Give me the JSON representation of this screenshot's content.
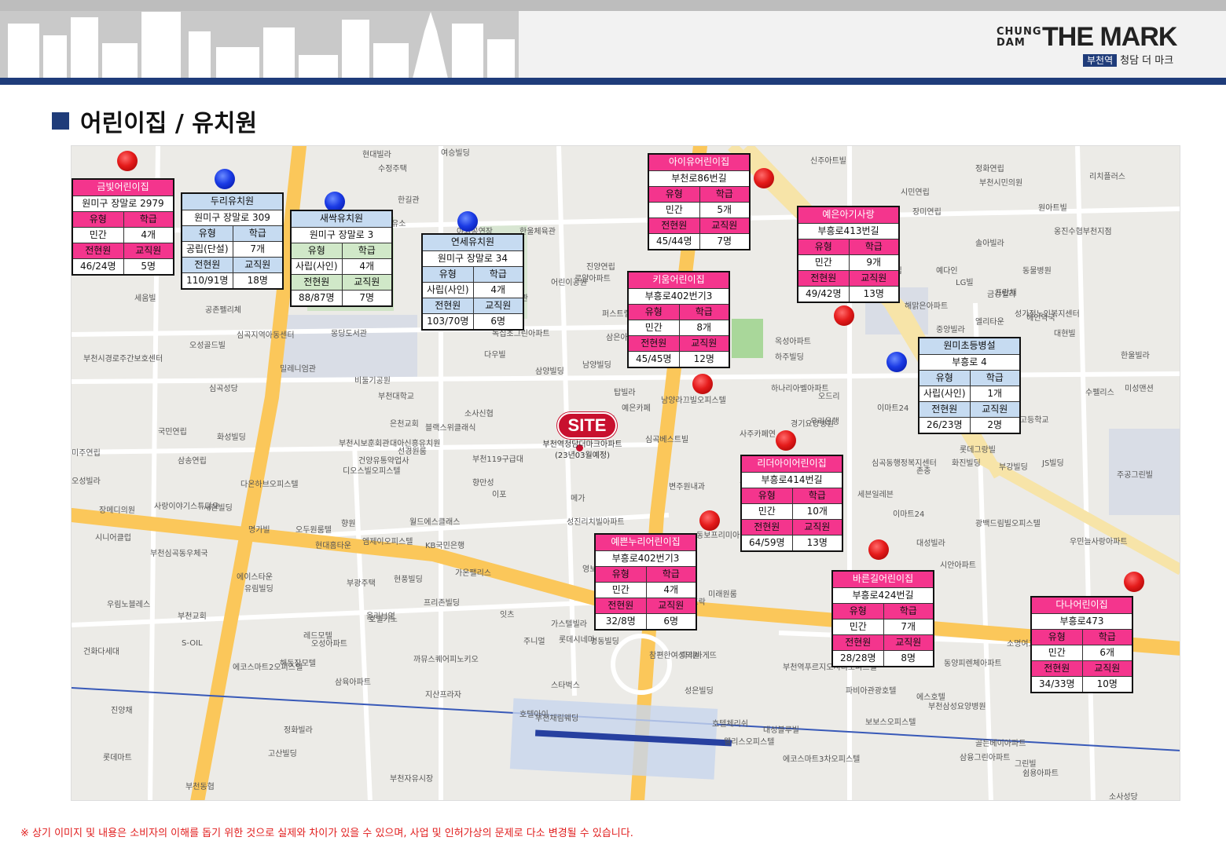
{
  "header": {
    "logo_small_1": "CHUNG",
    "logo_small_2": "DAM",
    "logo_big": "THE MARK",
    "logo_tag": "부천역",
    "logo_sub": "청담 더 마크"
  },
  "title": "어린이집 / 유치원",
  "footnote": "※ 상기 이미지 및 내용은 소비자의 이해를 돕기 위한 것으로 실제와 차이가 있을 수 있으며, 사업 및 인허가상의 문제로 다소 변경될 수 있습니다.",
  "site": {
    "badge": "SITE",
    "label_1": "부천역청담더마크아파트",
    "label_2": "(23년03월예정)"
  },
  "colors": {
    "pink": "#f4358d",
    "blue_header": "#c6dbf1",
    "green_header": "#d0e8c8",
    "brand_navy": "#1f3c7a"
  },
  "facilities": [
    {
      "name": "금빛어린이집",
      "address": "원미구 장말로 2979",
      "type_label": "유형",
      "class_label": "학급",
      "type": "민간",
      "classes": "4개",
      "staff_label": "전현원",
      "teacher_label": "교직원",
      "enrollment": "46/24명",
      "teachers": "5명"
    },
    {
      "name": "두리유치원",
      "address": "원미구 장말로 309",
      "type_label": "유형",
      "class_label": "학급",
      "type": "공립(단설)",
      "classes": "7개",
      "staff_label": "전현원",
      "teacher_label": "교직원",
      "enrollment": "110/91명",
      "teachers": "18명"
    },
    {
      "name": "새싹유치원",
      "address": "원미구 장말로 3",
      "type_label": "유형",
      "class_label": "학급",
      "type": "사립(사인)",
      "classes": "4개",
      "staff_label": "전현원",
      "teacher_label": "교직원",
      "enrollment": "88/87명",
      "teachers": "7명"
    },
    {
      "name": "연세유치원",
      "address": "원미구 장말로 34",
      "type_label": "유형",
      "class_label": "학급",
      "type": "사립(사인)",
      "classes": "4개",
      "staff_label": "전현원",
      "teacher_label": "교직원",
      "enrollment": "103/70명",
      "teachers": "6명"
    },
    {
      "name": "아이유어린이집",
      "address": "부천로86번길",
      "type_label": "유형",
      "class_label": "학급",
      "type": "민간",
      "classes": "5개",
      "staff_label": "전현원",
      "teacher_label": "교직원",
      "enrollment": "45/44명",
      "teachers": "7명"
    },
    {
      "name": "예은아기사랑",
      "address": "부흥로413번길",
      "type_label": "유형",
      "class_label": "학급",
      "type": "민간",
      "classes": "9개",
      "staff_label": "전현원",
      "teacher_label": "교직원",
      "enrollment": "49/42명",
      "teachers": "13명"
    },
    {
      "name": "키움어린이집",
      "address": "부흥로402번기3",
      "type_label": "유형",
      "class_label": "학급",
      "type": "민간",
      "classes": "8개",
      "staff_label": "전현원",
      "teacher_label": "교직원",
      "enrollment": "45/45명",
      "teachers": "12명"
    },
    {
      "name": "원미초등병설",
      "address": "부흥로 4",
      "type_label": "유형",
      "class_label": "학급",
      "type": "사립(사인)",
      "classes": "1개",
      "staff_label": "전현원",
      "teacher_label": "교직원",
      "enrollment": "26/23명",
      "teachers": "2명"
    },
    {
      "name": "리더아이어린이집",
      "address": "부흥로414번길",
      "type_label": "유형",
      "class_label": "학급",
      "type": "민간",
      "classes": "10개",
      "staff_label": "전현원",
      "teacher_label": "교직원",
      "enrollment": "64/59명",
      "teachers": "13명"
    },
    {
      "name": "예쁜누리어린이집",
      "address": "부흥로402번기3",
      "type_label": "유형",
      "class_label": "학급",
      "type": "민간",
      "classes": "4개",
      "staff_label": "전현원",
      "teacher_label": "교직원",
      "enrollment": "32/8명",
      "teachers": "6명"
    },
    {
      "name": "바른길어린이집",
      "address": "부흥로424번길",
      "type_label": "유형",
      "class_label": "학급",
      "type": "민간",
      "classes": "7개",
      "staff_label": "전현원",
      "teacher_label": "교직원",
      "enrollment": "28/28명",
      "teachers": "8명"
    },
    {
      "name": "다나어린이집",
      "address": "부흥로473",
      "type_label": "유형",
      "class_label": "학급",
      "type": "민간",
      "classes": "6개",
      "staff_label": "전현원",
      "teacher_label": "교직원",
      "enrollment": "34/33명",
      "teachers": "10명"
    }
  ],
  "map_labels": [
    "현대빌라",
    "수정주택",
    "여승빌딩",
    "정화연립",
    "부천시민의원",
    "세움빌",
    "공존펠리체",
    "심곡지역아동센터",
    "부천시경로주간보호센터",
    "오성골드빌",
    "밀레니엄관",
    "심곡성당",
    "부천대학교",
    "소사신협",
    "삼양빌딩",
    "국민연립",
    "화성빌딩",
    "미주연립",
    "삼송연립",
    "오성빌라",
    "장메디의원",
    "사랑이야기스튜디오",
    "새한빌딩",
    "시니어클럽",
    "부천심곡동우체국",
    "에이스타운",
    "유림빌딩",
    "우림노블레스",
    "부천교회",
    "S-OIL",
    "건화다세대",
    "에코스마트2오피스텔",
    "해동장모텔",
    "삼육아파트",
    "진양채",
    "롯데마트",
    "부천동협",
    "정화빌라",
    "고산빌딩",
    "부천자유시장",
    "현대홈타운",
    "엠제이오피스텔",
    "월드에스클래스",
    "가온팰리스",
    "프리존빌딩",
    "현풍빌딩",
    "호텔키노",
    "레드모텔",
    "오성아파트",
    "까뮤스퀘어피노키오",
    "지산프라자",
    "스타벅스",
    "호텔아이",
    "부천채림웨딩",
    "웰리스오피스텔",
    "참편한여성의원",
    "파리바게뜨",
    "성은빌딩",
    "호텔체리쉬",
    "대성블루빌",
    "에코스마트3차오피스텔",
    "부천역푸르지오시티오피스텔",
    "파비아관광호텔",
    "보보스오피스텔",
    "에스호텔",
    "부천삼성요양병원",
    "삼융그린아파트",
    "그린빌",
    "골든베이아파트",
    "쉼용아파트",
    "소사성당",
    "오투모텔",
    "소명여고사거리",
    "동양피렌체아파트",
    "우민늘사랑아파트",
    "광백드림빌오피스텔",
    "대성빌라",
    "시안아파트",
    "세븐일레븐",
    "이마트24",
    "심곡동행정복지센터",
    "존충",
    "롯데그랑빌",
    "부강빌딩",
    "화진빌딩",
    "JS빌딩",
    "주공그린빌",
    "소명여자고등학교",
    "범신빌라",
    "수펠리스",
    "미성맨션",
    "한울빌라",
    "대현빌",
    "성가정노인복지센터",
    "금강빌라",
    "중앙빌라",
    "해맑은아파트",
    "메트로센트로아파트",
    "풍전연립",
    "예다인",
    "LG빌",
    "프란채",
    "엘리타운",
    "동물병원",
    "헤인약국",
    "옹진수협부천지점",
    "리치플러스",
    "원아트빌",
    "솔아빌라",
    "장미연립",
    "시민연립",
    "신주아트빌",
    "옥성아파트",
    "하주빌딩",
    "하나리아벨아파트",
    "이마트24",
    "오드리",
    "경기요양병원",
    "우리은행",
    "사주카페연",
    "심곡베스트빌",
    "예은카페",
    "변주원내과",
    "센터시티오피스텔",
    "젠모텔",
    "동보프리미아아파트",
    "성진리치빌아파트",
    "메가",
    "이포",
    "향만성",
    "부천119구급대",
    "부천시보훈회관",
    "은천교회",
    "대아신흥유치원",
    "건양유통약업사",
    "선경원룸",
    "디오스빌오피스텔",
    "다온하브오피스텔",
    "명가빌",
    "오두원룸텔",
    "향원",
    "KB국민은행",
    "올리브영",
    "잇츠",
    "롯데시네마",
    "주니멀",
    "명동빌딩",
    "해밀뜨락",
    "영보빌딩",
    "두리아파트",
    "가스텔빌라",
    "미래원룸",
    "부광주택",
    "블랙스위클래식",
    "녹십초그린아파트",
    "퍼스트랠리스아파트",
    "삼은아이조은빌",
    "기성부그리안아파트",
    "남양라끄빌오피스텔",
    "탑빌라",
    "남양빌딩",
    "광명연립",
    "어린이공원",
    "다우빌",
    "미니스톱",
    "진양연립",
    "한울체육관",
    "몽당기념관",
    "야외공연장",
    "한길관",
    "SK주유소",
    "로얄아파트",
    "비둘기공원",
    "몽당도서관"
  ]
}
